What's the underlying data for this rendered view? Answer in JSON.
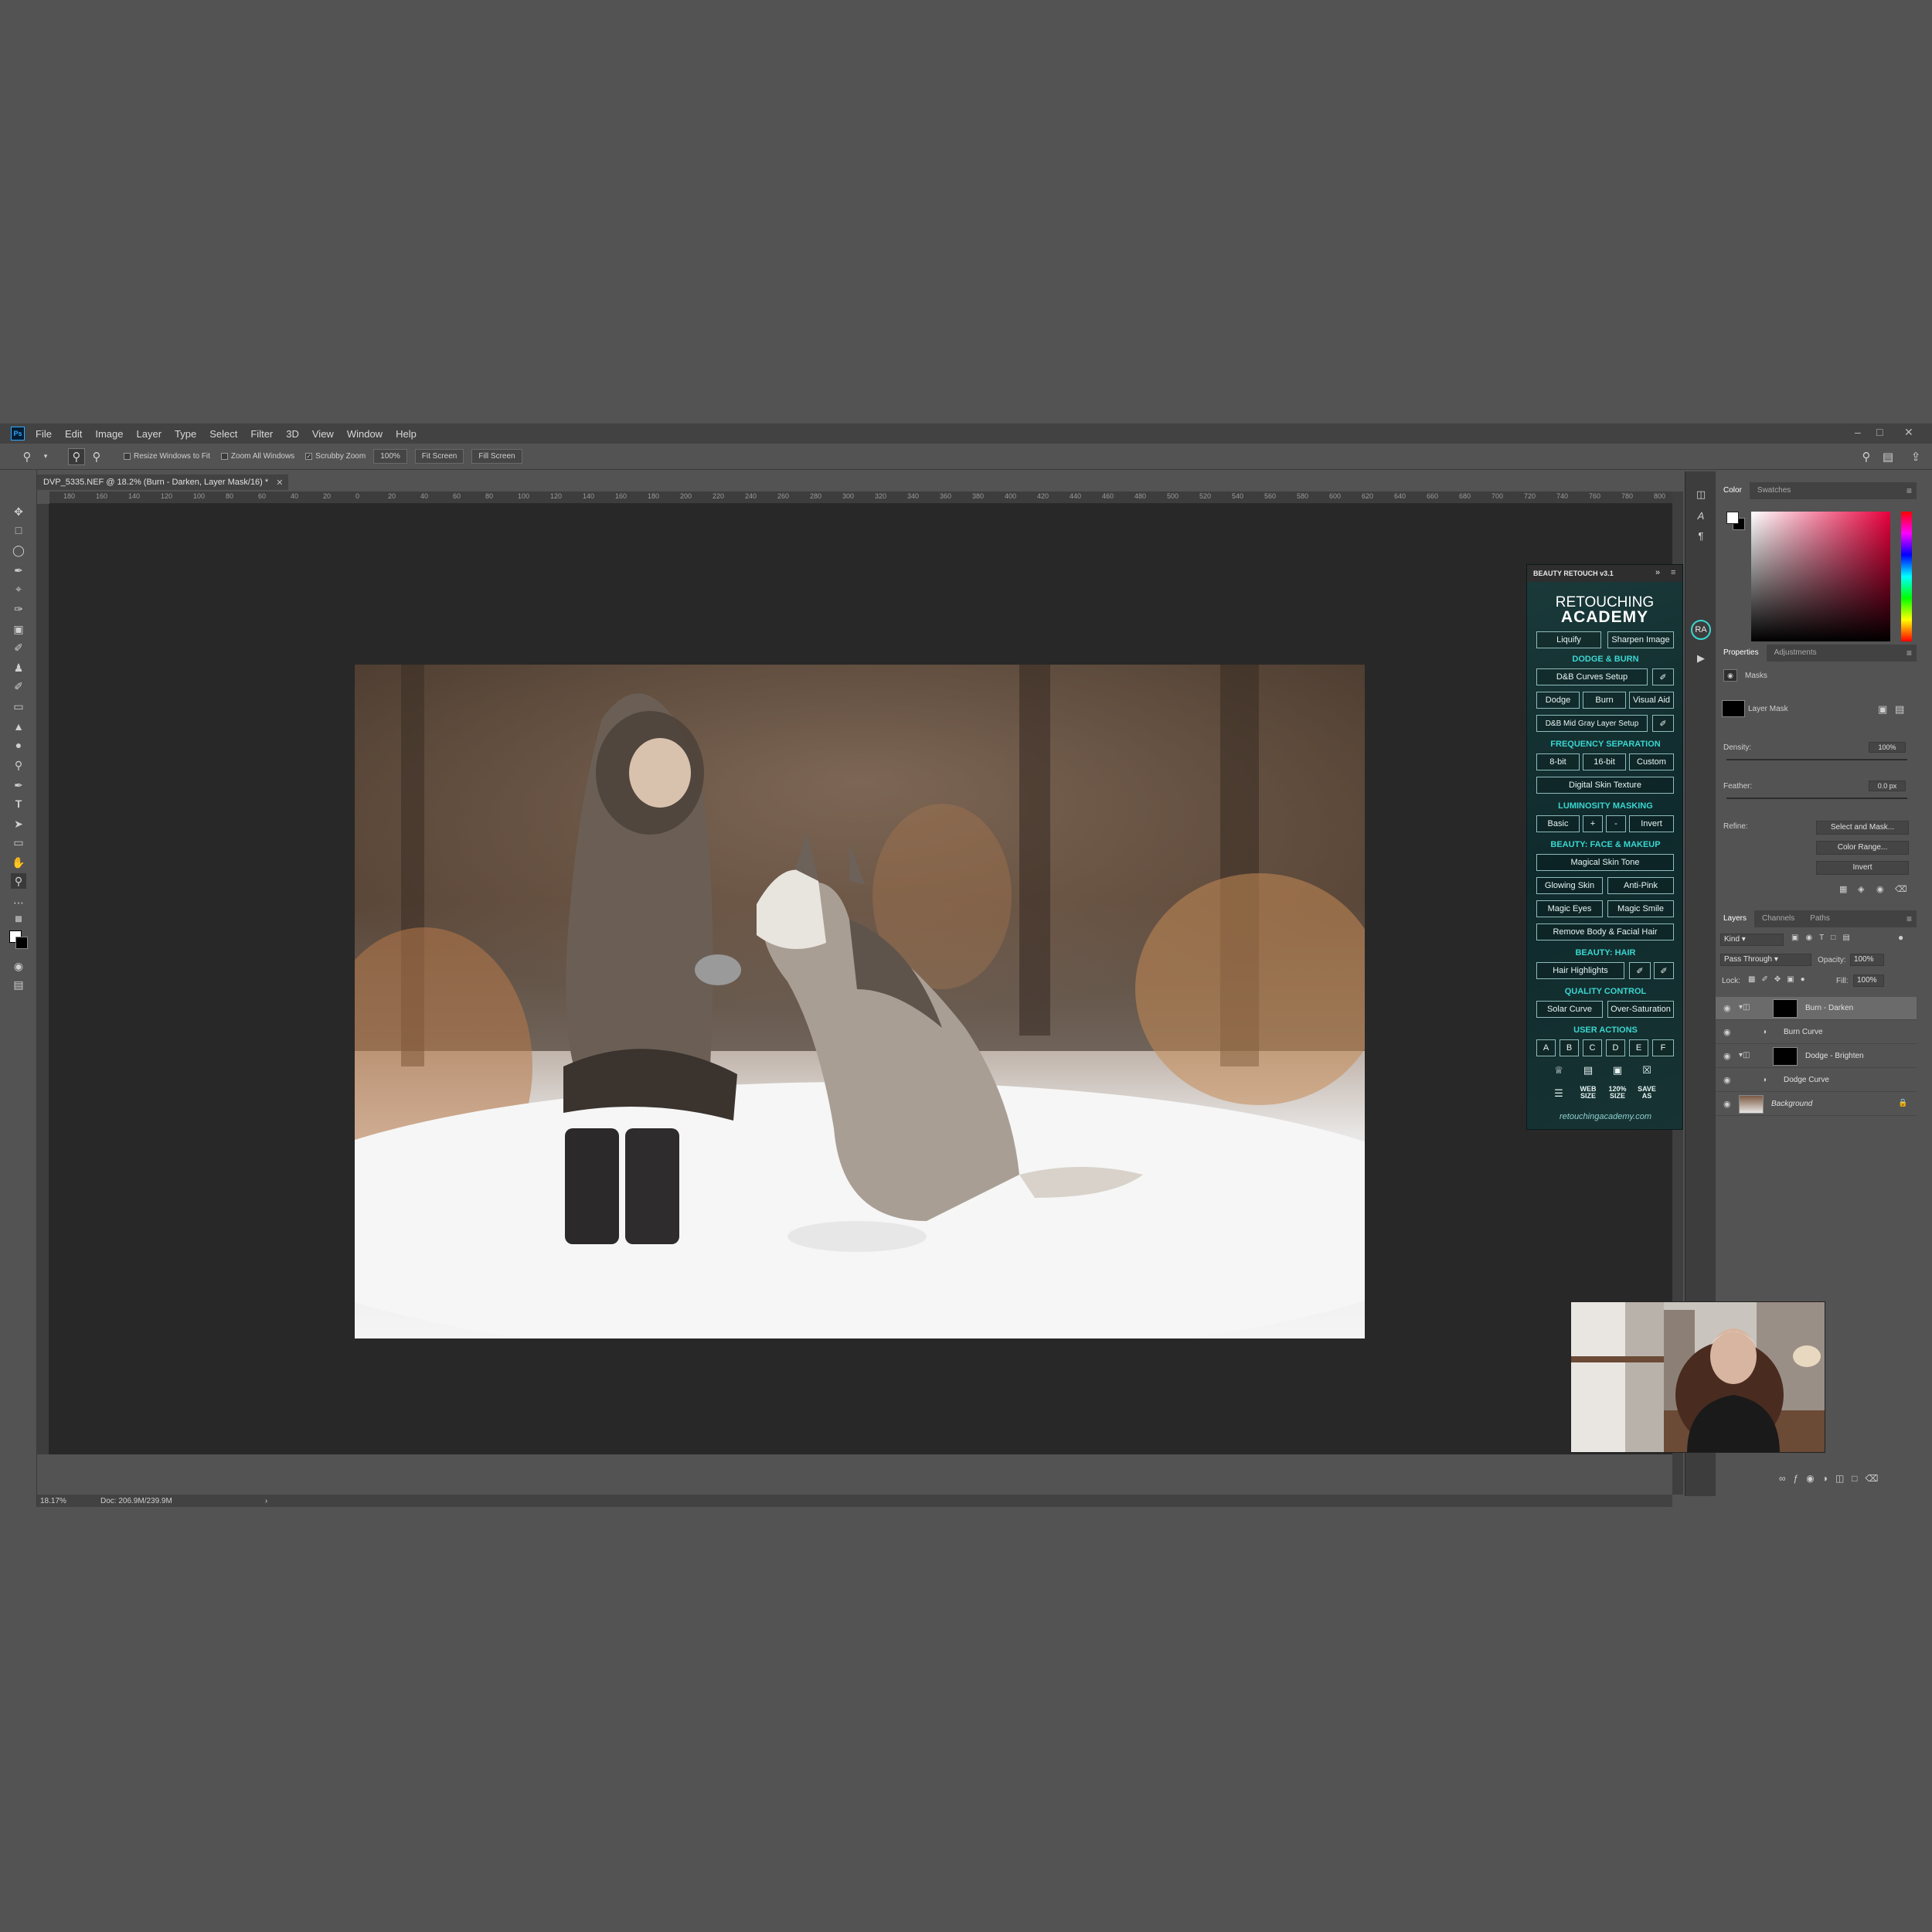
{
  "menubar": {
    "logo": "Ps",
    "items": [
      "File",
      "Edit",
      "Image",
      "Layer",
      "Type",
      "Select",
      "Filter",
      "3D",
      "View",
      "Window",
      "Help"
    ]
  },
  "options": {
    "resize_windows": "Resize Windows to Fit",
    "zoom_all": "Zoom All Windows",
    "scrubby_zoom": "Scrubby Zoom",
    "zoom_value": "100%",
    "fit_screen": "Fit Screen",
    "fill_screen": "Fill Screen"
  },
  "document": {
    "tab_title": "DVP_5335.NEF @ 18.2% (Burn - Darken, Layer Mask/16) *",
    "ruler_ticks": [
      "180",
      "160",
      "140",
      "120",
      "100",
      "80",
      "60",
      "40",
      "20",
      "0",
      "20",
      "40",
      "60",
      "80",
      "100",
      "120",
      "140",
      "160",
      "180",
      "200",
      "220",
      "240",
      "260",
      "280",
      "300",
      "320",
      "340",
      "360",
      "380",
      "400",
      "420",
      "440",
      "460",
      "480",
      "500",
      "520",
      "540",
      "560",
      "580",
      "600",
      "620",
      "640",
      "660",
      "680",
      "700",
      "720",
      "740",
      "760",
      "780",
      "800"
    ],
    "status_zoom": "18.17%",
    "status_doc": "Doc: 206.9M/239.9M"
  },
  "plugin": {
    "title": "BEAUTY RETOUCH v3.1",
    "logo_line1": "RETOUCHING",
    "logo_line2": "ACADEMY",
    "liquify": "Liquify",
    "sharpen": "Sharpen Image",
    "sec_dodge_burn": "DODGE & BURN",
    "db_curves": "D&B Curves Setup",
    "dodge": "Dodge",
    "burn": "Burn",
    "visual_aid": "Visual Aid",
    "db_midgray": "D&B Mid Gray Layer Setup",
    "sec_freq": "FREQUENCY SEPARATION",
    "bit8": "8-bit",
    "bit16": "16-bit",
    "custom": "Custom",
    "digital_skin": "Digital Skin Texture",
    "sec_lum": "LUMINOSITY MASKING",
    "basic": "Basic",
    "plus": "+",
    "minus": "-",
    "invert": "Invert",
    "sec_face": "BEAUTY: FACE & MAKEUP",
    "magical_skin": "Magical Skin Tone",
    "glowing_skin": "Glowing Skin",
    "anti_pink": "Anti-Pink",
    "magic_eyes": "Magic Eyes",
    "magic_smile": "Magic Smile",
    "remove_hair": "Remove Body & Facial Hair",
    "sec_hair": "BEAUTY: HAIR",
    "hair_highlights": "Hair Highlights",
    "sec_quality": "QUALITY CONTROL",
    "solar_curve": "Solar Curve",
    "over_saturation": "Over-Saturation",
    "sec_user": "USER ACTIONS",
    "user_actions": [
      "A",
      "B",
      "C",
      "D",
      "E",
      "F"
    ],
    "web_size": "WEB SIZE",
    "size_120": "120% SIZE",
    "save_as": "SAVE AS",
    "url": "retouchingacademy.com"
  },
  "panels": {
    "color_tab": "Color",
    "swatches_tab": "Swatches",
    "properties_tab": "Properties",
    "adjustments_tab": "Adjustments",
    "masks_label": "Masks",
    "layer_mask_label": "Layer Mask",
    "density_label": "Density:",
    "density_value": "100%",
    "feather_label": "Feather:",
    "feather_value": "0.0 px",
    "refine_label": "Refine:",
    "select_and_mask": "Select and Mask...",
    "color_range": "Color Range...",
    "invert": "Invert",
    "layers_tab": "Layers",
    "channels_tab": "Channels",
    "paths_tab": "Paths",
    "kind_filter": "Kind",
    "blend_mode": "Pass Through",
    "opacity_label": "Opacity:",
    "opacity_value": "100%",
    "lock_label": "Lock:",
    "fill_label": "Fill:",
    "fill_value": "100%",
    "layers": [
      {
        "name": "Burn - Darken"
      },
      {
        "name": "Burn Curve"
      },
      {
        "name": "Dodge - Brighten"
      },
      {
        "name": "Dodge Curve"
      },
      {
        "name": "Background"
      }
    ]
  },
  "icons": {
    "eye": "eye-icon",
    "folder": "folder-icon",
    "lock": "lock-icon"
  },
  "colors": {
    "accent_cyan": "#3ad6d0",
    "selection_gray": "#6b6b6b"
  }
}
